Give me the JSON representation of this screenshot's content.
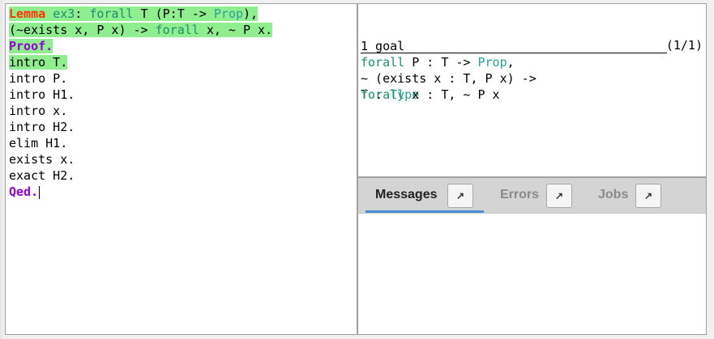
{
  "editor": {
    "lines": [
      {
        "segments": [
          {
            "t": "Lemma",
            "c": "kw-red"
          },
          {
            "t": " ",
            "c": "tx"
          },
          {
            "t": "ex3",
            "c": "id"
          },
          {
            "t": ": ",
            "c": "tx"
          },
          {
            "t": "forall",
            "c": "id"
          },
          {
            "t": " T (P:T -> ",
            "c": "tx"
          },
          {
            "t": "Prop",
            "c": "ty"
          },
          {
            "t": "),",
            "c": "tx"
          }
        ],
        "highlight": true
      },
      {
        "segments": [
          {
            "t": "(~exists x, P x) -> ",
            "c": "tx"
          },
          {
            "t": "forall",
            "c": "id"
          },
          {
            "t": " x, ~ P x.",
            "c": "tx"
          }
        ],
        "highlight": true
      },
      {
        "segments": [
          {
            "t": "Proof.",
            "c": "kw-purple"
          }
        ],
        "highlight": true
      },
      {
        "segments": [
          {
            "t": "intro T.",
            "c": "tx"
          }
        ],
        "highlight": true
      },
      {
        "segments": [
          {
            "t": "intro P.",
            "c": "tx"
          }
        ],
        "highlight": false
      },
      {
        "segments": [
          {
            "t": "intro H1.",
            "c": "tx"
          }
        ],
        "highlight": false
      },
      {
        "segments": [
          {
            "t": "intro x.",
            "c": "tx"
          }
        ],
        "highlight": false
      },
      {
        "segments": [
          {
            "t": "intro H2.",
            "c": "tx"
          }
        ],
        "highlight": false
      },
      {
        "segments": [
          {
            "t": "elim H1.",
            "c": "tx"
          }
        ],
        "highlight": false
      },
      {
        "segments": [
          {
            "t": "exists x.",
            "c": "tx"
          }
        ],
        "highlight": false
      },
      {
        "segments": [
          {
            "t": "exact H2.",
            "c": "tx"
          }
        ],
        "highlight": false
      },
      {
        "segments": [
          {
            "t": "Qed.",
            "c": "kw-purple"
          }
        ],
        "highlight": false,
        "cursor": true
      }
    ]
  },
  "goals": {
    "count_label": "1 goal",
    "hyp_name": "T : ",
    "hyp_type": "Type",
    "goal_index": "(1/1)",
    "conclusion": [
      {
        "segments": [
          {
            "t": "forall",
            "c": "id"
          },
          {
            "t": " P : T -> ",
            "c": "tx"
          },
          {
            "t": "Prop",
            "c": "ty"
          },
          {
            "t": ",",
            "c": "tx"
          }
        ]
      },
      {
        "segments": [
          {
            "t": "~ (exists x : T, P x) ->",
            "c": "tx"
          }
        ]
      },
      {
        "segments": [
          {
            "t": "forall",
            "c": "id"
          },
          {
            "t": " x : T, ~ P x",
            "c": "tx"
          }
        ]
      }
    ]
  },
  "messages_panel": {
    "tabs": [
      {
        "label": "Messages",
        "button": "↗",
        "active": true
      },
      {
        "label": "Errors",
        "button": "↗",
        "active": false
      },
      {
        "label": "Jobs",
        "button": "↗",
        "active": false
      }
    ]
  },
  "colors": {
    "highlight": "#90ee90",
    "keyword_red": "#ff3300",
    "keyword_purple": "#9400d3",
    "identifier": "#1a8f6f",
    "type": "#2aa198",
    "tab_underline": "#4a90d9"
  }
}
